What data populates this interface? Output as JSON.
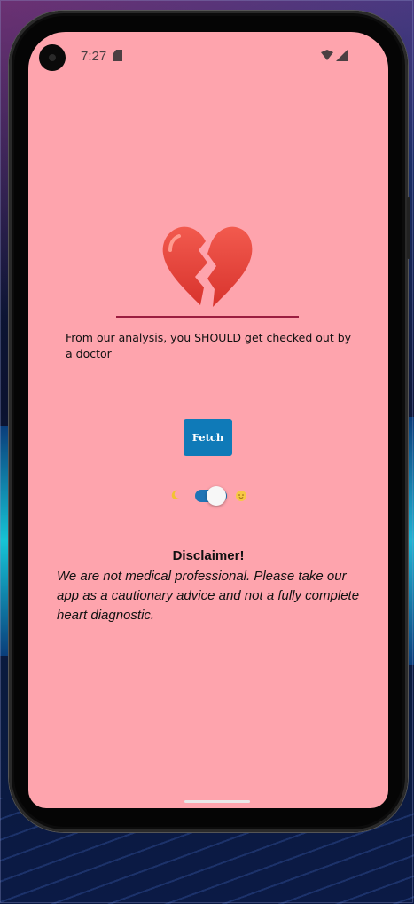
{
  "status_bar": {
    "time": "7:27",
    "icons": [
      "camera-icon",
      "sim-card-icon",
      "wifi-icon",
      "signal-icon"
    ]
  },
  "result": {
    "icon": "broken-heart-icon",
    "message": "From our analysis, you SHOULD get checked out by a doctor"
  },
  "fetch_button": {
    "label": "Fetch"
  },
  "theme_toggle": {
    "left_icon": "moon-icon",
    "right_icon": "sun-icon",
    "state": "light"
  },
  "disclaimer": {
    "title": "Disclaimer!",
    "body": "We are not medical professional. Please take our app as a cautionary advice and not a fully complete heart diagnostic."
  },
  "colors": {
    "screen_background": "#fea4ad",
    "divider": "#9b1c3f",
    "button": "#0f7ab8",
    "toggle_track": "#1f74b5"
  }
}
